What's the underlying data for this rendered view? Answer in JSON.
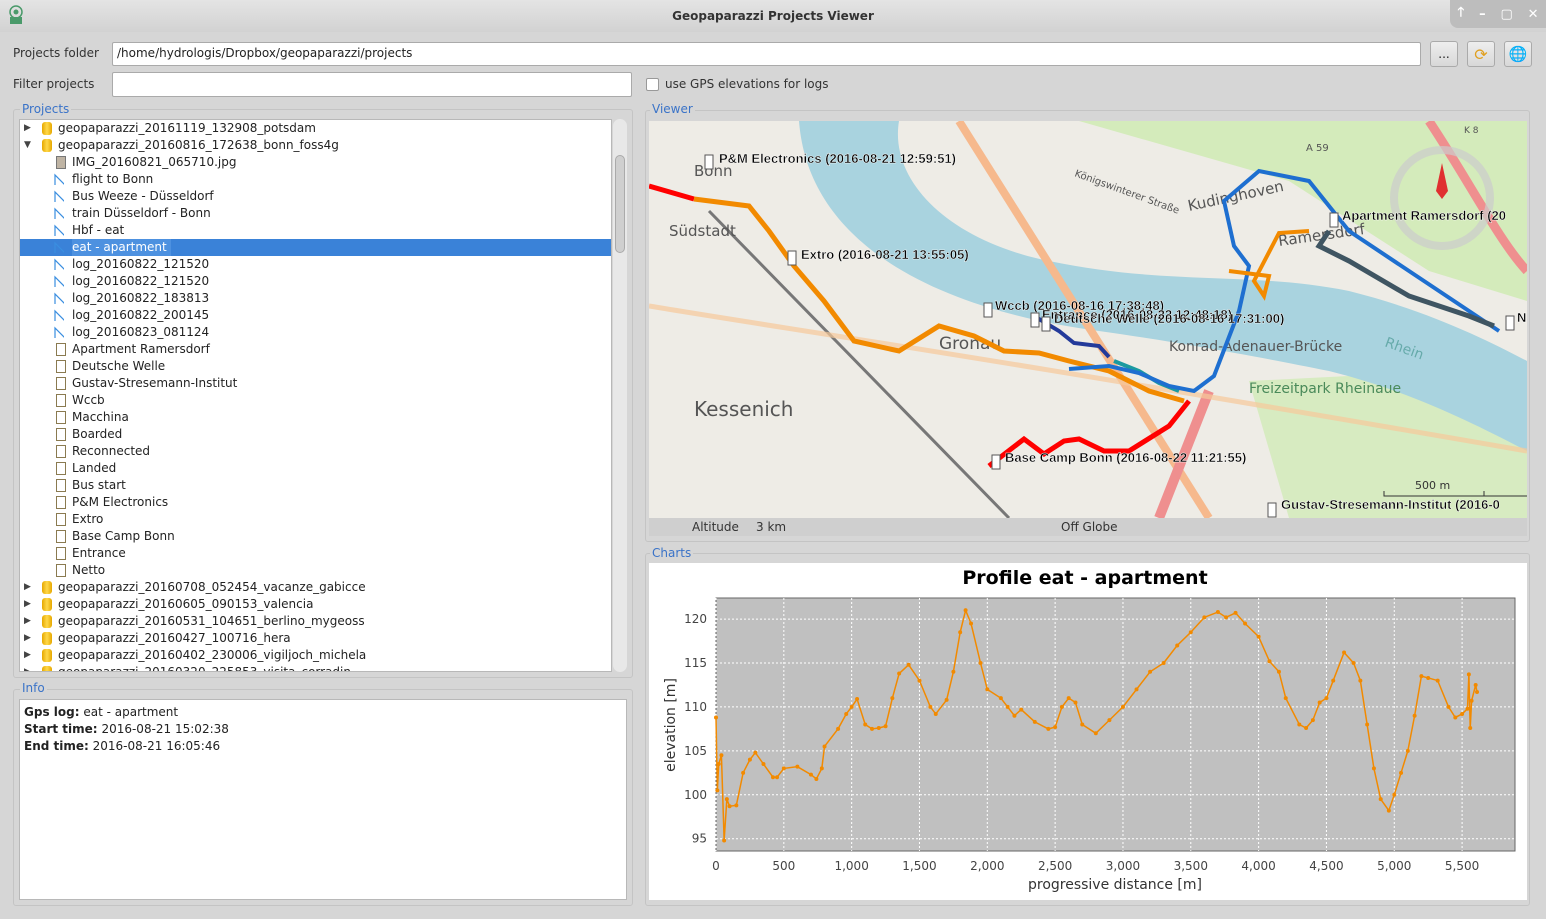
{
  "window": {
    "title": "Geopaparazzi Projects Viewer",
    "controls": [
      "🡑",
      "–",
      "▢",
      "✕"
    ]
  },
  "toolbar": {
    "projects_folder_label": "Projects folder",
    "projects_folder_value": "/home/hydrologis/Dropbox/geopaparazzi/projects",
    "browse_label": "...",
    "filter_label": "Filter projects",
    "filter_value": "",
    "gps_elev_label": "use GPS elevations for logs",
    "gps_elev_checked": false
  },
  "projects": {
    "title": "Projects",
    "items": [
      {
        "level": 0,
        "type": "project",
        "expanded": false,
        "label": "geopaparazzi_20161119_132908_potsdam"
      },
      {
        "level": 0,
        "type": "project",
        "expanded": true,
        "label": "geopaparazzi_20160816_172638_bonn_foss4g"
      },
      {
        "level": 1,
        "type": "image",
        "label": "IMG_20160821_065710.jpg"
      },
      {
        "level": 1,
        "type": "log",
        "label": "flight to Bonn"
      },
      {
        "level": 1,
        "type": "log",
        "label": "Bus Weeze - Düsseldorf"
      },
      {
        "level": 1,
        "type": "log",
        "label": "train Düsseldorf - Bonn"
      },
      {
        "level": 1,
        "type": "log",
        "label": "Hbf - eat"
      },
      {
        "level": 1,
        "type": "log",
        "label": "eat - apartment",
        "selected": true
      },
      {
        "level": 1,
        "type": "log",
        "label": "log_20160822_121520"
      },
      {
        "level": 1,
        "type": "log",
        "label": "log_20160822_121520"
      },
      {
        "level": 1,
        "type": "log",
        "label": "log_20160822_183813"
      },
      {
        "level": 1,
        "type": "log",
        "label": "log_20160822_200145"
      },
      {
        "level": 1,
        "type": "log",
        "label": "log_20160823_081124"
      },
      {
        "level": 1,
        "type": "note",
        "label": "Apartment Ramersdorf"
      },
      {
        "level": 1,
        "type": "note",
        "label": "Deutsche Welle"
      },
      {
        "level": 1,
        "type": "note",
        "label": "Gustav-Stresemann-Institut"
      },
      {
        "level": 1,
        "type": "note",
        "label": "Wccb"
      },
      {
        "level": 1,
        "type": "note",
        "label": "Macchina"
      },
      {
        "level": 1,
        "type": "note",
        "label": "Boarded"
      },
      {
        "level": 1,
        "type": "note",
        "label": "Reconnected"
      },
      {
        "level": 1,
        "type": "note",
        "label": "Landed"
      },
      {
        "level": 1,
        "type": "note",
        "label": "Bus start"
      },
      {
        "level": 1,
        "type": "note",
        "label": "P&M Electronics"
      },
      {
        "level": 1,
        "type": "note",
        "label": "Extro"
      },
      {
        "level": 1,
        "type": "note",
        "label": "Base Camp Bonn"
      },
      {
        "level": 1,
        "type": "note",
        "label": "Entrance"
      },
      {
        "level": 1,
        "type": "note",
        "label": "Netto"
      },
      {
        "level": 0,
        "type": "project",
        "expanded": false,
        "label": "geopaparazzi_20160708_052454_vacanze_gabicce"
      },
      {
        "level": 0,
        "type": "project",
        "expanded": false,
        "label": "geopaparazzi_20160605_090153_valencia"
      },
      {
        "level": 0,
        "type": "project",
        "expanded": false,
        "label": "geopaparazzi_20160531_104651_berlino_mygeoss"
      },
      {
        "level": 0,
        "type": "project",
        "expanded": false,
        "label": "geopaparazzi_20160427_100716_hera"
      },
      {
        "level": 0,
        "type": "project",
        "expanded": false,
        "label": "geopaparazzi_20160402_230006_vigiljoch_michela"
      },
      {
        "level": 0,
        "type": "project",
        "expanded": false,
        "label": "geopaparazzi_20160320_225853_visita_corradin"
      }
    ]
  },
  "info": {
    "title": "Info",
    "gps_log_key": "Gps log:",
    "gps_log": "eat - apartment",
    "start_key": "Start time:",
    "start": "2016-08-21 15:02:38",
    "end_key": "End time:",
    "end": "2016-08-21 16:05:46"
  },
  "viewer": {
    "title": "Viewer",
    "altitude_label": "Altitude",
    "altitude_value": "3 km",
    "globe_status": "Off Globe",
    "scale_label": "500 m",
    "place_labels": [
      "Bonn",
      "Südstadt",
      "Gronau",
      "Kessenich",
      "Kudinghoven",
      "Ramersdorf",
      "Rhein",
      "Konrad-Adenauer-Brücke",
      "Freizeitpark Rheinaue",
      "A 59",
      "K 8",
      "Königswinterer Straße"
    ],
    "markers": [
      "P&M Electronics (2016-08-21 12:59:51)",
      "Extro (2016-08-21 13:55:05)",
      "Wccb (2016-08-16 17:38:48)",
      "Entrance (2016-08-22 12:48:18)",
      "Deutsche Welle (2016-08-16 17:31:00)",
      "Apartment Ramersdorf (20",
      "Base Camp Bonn (2016-08-22 11:21:55)",
      "Gustav-Stresemann-Institut (2016-0",
      "N"
    ],
    "colors": {
      "water": "#a9d3df",
      "park": "#cdebb0",
      "track_red": "#ff0000",
      "track_orange": "#f28a00",
      "track_blue": "#1e6fd0",
      "track_navy": "#233a9a",
      "track_slate": "#3f5562",
      "track_teal": "#1a9aa0"
    }
  },
  "charts": {
    "title": "Charts"
  },
  "chart_data": {
    "type": "line",
    "title": "Profile eat - apartment",
    "xlabel": "progressive distance [m]",
    "ylabel": "elevation [m]",
    "xlim": [
      0,
      5890
    ],
    "ylim": [
      93.6,
      122.4
    ],
    "xticks": [
      0,
      500,
      1000,
      1500,
      2000,
      2500,
      3000,
      3500,
      4000,
      4500,
      5000,
      5500
    ],
    "xtick_labels": [
      "0",
      "500",
      "1,000",
      "1,500",
      "2,000",
      "2,500",
      "3,000",
      "3,500",
      "4,000",
      "4,500",
      "5,000",
      "5,500"
    ],
    "yticks": [
      95,
      100,
      105,
      110,
      115,
      120
    ],
    "grid": true,
    "color": "#f28a00",
    "background": "#c0c0c0",
    "x": [
      0,
      10,
      20,
      40,
      60,
      80,
      100,
      150,
      200,
      250,
      290,
      350,
      420,
      450,
      500,
      600,
      700,
      740,
      780,
      800,
      900,
      960,
      1000,
      1040,
      1100,
      1150,
      1200,
      1250,
      1300,
      1350,
      1420,
      1500,
      1580,
      1620,
      1700,
      1750,
      1800,
      1840,
      1880,
      1950,
      2000,
      2100,
      2150,
      2200,
      2250,
      2350,
      2450,
      2500,
      2550,
      2600,
      2650,
      2700,
      2800,
      2900,
      3000,
      3100,
      3200,
      3300,
      3400,
      3500,
      3600,
      3700,
      3760,
      3830,
      3900,
      4000,
      4080,
      4150,
      4200,
      4300,
      4350,
      4400,
      4450,
      4500,
      4550,
      4630,
      4700,
      4750,
      4800,
      4850,
      4900,
      4960,
      5000,
      5050,
      5100,
      5150,
      5200,
      5250,
      5320,
      5400,
      5450,
      5500,
      5540,
      5550,
      5560,
      5570,
      5600,
      5610
    ],
    "y": [
      108.8,
      100.5,
      103.5,
      104.5,
      94.8,
      99.5,
      98.7,
      98.8,
      102.5,
      104,
      104.8,
      103.5,
      102,
      102,
      103,
      103.2,
      102.3,
      101.8,
      103,
      105.5,
      107.5,
      109.2,
      110,
      110.9,
      108,
      107.5,
      107.6,
      107.8,
      111,
      113.8,
      114.8,
      113,
      110,
      109.2,
      110.8,
      114,
      118.5,
      121,
      119.5,
      115,
      112,
      111,
      110,
      109,
      109.7,
      108.3,
      107.5,
      107.7,
      110,
      111,
      110.5,
      108,
      107,
      108.5,
      110,
      112,
      114,
      115,
      117,
      118.5,
      120.2,
      120.8,
      120.2,
      120.7,
      119.5,
      118,
      115.2,
      114,
      111,
      108,
      107.6,
      108.5,
      110.5,
      111,
      113,
      116.2,
      115,
      113,
      108,
      103,
      99.5,
      98.2,
      100,
      102.5,
      105,
      109,
      113.5,
      113.3,
      113,
      110,
      108.8,
      109.2,
      109.8,
      113.7,
      107.6,
      110.7,
      112.5,
      111.7
    ]
  }
}
